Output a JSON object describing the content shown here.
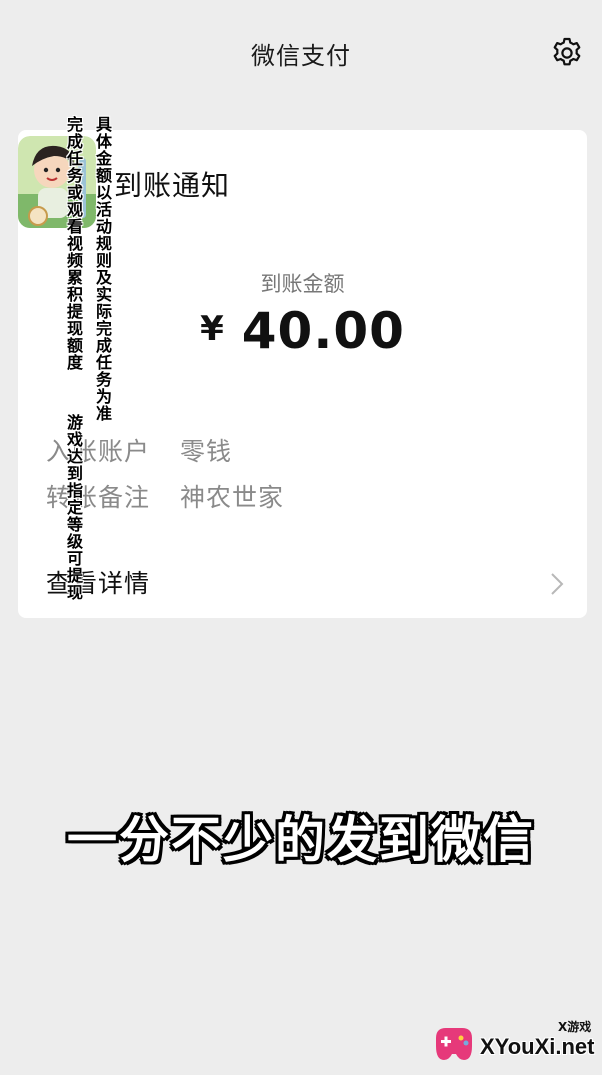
{
  "header": {
    "title": "微信支付",
    "settings_icon": "gear-icon"
  },
  "notice": {
    "title": "到账通知",
    "amount_label": "到账金额",
    "currency": "¥",
    "amount": "40.00",
    "rows": [
      {
        "key": "入账账户",
        "value": "零钱"
      },
      {
        "key": "转账备注",
        "value": "神农世家"
      }
    ],
    "details_label": "查看详情",
    "details_icon": "chevron-right-icon"
  },
  "overlay": {
    "vertical_notes": [
      "完成任务或观看视频累积提现额度",
      "具体金额以活动规则及实际完成任务为准",
      "游戏达到指定等级可提现"
    ],
    "caption": "一分不少的发到微信"
  },
  "watermark": {
    "small_text": "X游戏",
    "site": "XYouXi.net"
  },
  "colors": {
    "background": "#ededed",
    "card": "#ffffff",
    "muted_text": "#8a8a8a",
    "brand_pink": "#e6397a"
  }
}
